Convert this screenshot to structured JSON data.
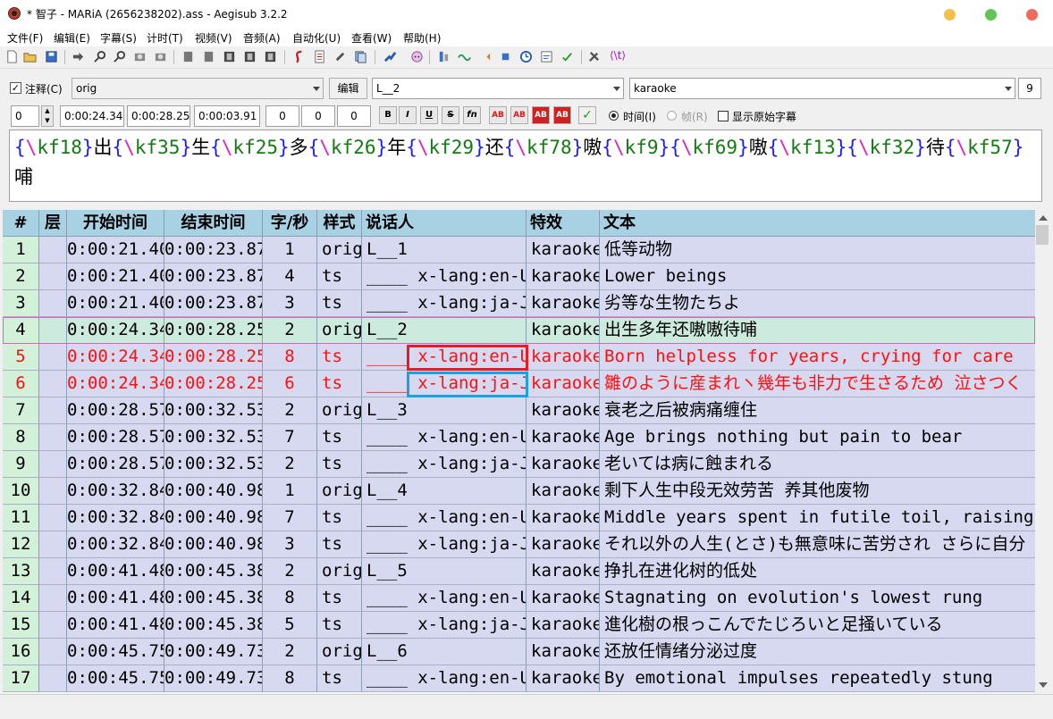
{
  "window": {
    "title": "* 智子 - MARiA (2656238202).ass - Aegisub 3.2.2",
    "buttons": [
      {
        "name": "minimize-button",
        "color": "#f5bf4f"
      },
      {
        "name": "maximize-button",
        "color": "#61c454"
      },
      {
        "name": "close-button",
        "color": "#ee6a5f"
      }
    ]
  },
  "menu": [
    "文件(F)",
    "编辑(E)",
    "字幕(S)",
    "计时(T)",
    "视频(V)",
    "音频(A)",
    "自动化(U)",
    "查看(W)",
    "帮助(H)"
  ],
  "edit": {
    "comment_label": "注释(C)",
    "comment_checked": true,
    "style_value": "orig",
    "edit_button": "编辑",
    "actor_value": "L__2",
    "effect_value": "karaoke",
    "char_count": "9",
    "layer": "0",
    "start_time": "0:00:24.34",
    "end_time": "0:00:28.25",
    "duration": "0:00:03.91",
    "margin_left": "0",
    "margin_right": "0",
    "margin_vert": "0",
    "format_buttons": [
      "B",
      "I",
      "U",
      "S",
      "fn"
    ],
    "color_buttons": [
      "AB",
      "AB",
      "AB",
      "AB"
    ],
    "time_label": "时间(I)",
    "frame_label": "帧(R)",
    "show_original_label": "显示原始字幕",
    "text_tokens": [
      {
        "t": "{",
        "c": "#1e1ef0"
      },
      {
        "t": "\\",
        "c": "#e01ec8"
      },
      {
        "t": "kf18",
        "c": "#147a14"
      },
      {
        "t": "}",
        "c": "#1e1ef0"
      },
      {
        "t": "出",
        "c": "#000000"
      },
      {
        "t": "{",
        "c": "#1e1ef0"
      },
      {
        "t": "\\",
        "c": "#e01ec8"
      },
      {
        "t": "kf35",
        "c": "#147a14"
      },
      {
        "t": "}",
        "c": "#1e1ef0"
      },
      {
        "t": "生",
        "c": "#000000"
      },
      {
        "t": "{",
        "c": "#1e1ef0"
      },
      {
        "t": "\\",
        "c": "#e01ec8"
      },
      {
        "t": "kf25",
        "c": "#147a14"
      },
      {
        "t": "}",
        "c": "#1e1ef0"
      },
      {
        "t": "多",
        "c": "#000000"
      },
      {
        "t": "{",
        "c": "#1e1ef0"
      },
      {
        "t": "\\",
        "c": "#e01ec8"
      },
      {
        "t": "kf26",
        "c": "#147a14"
      },
      {
        "t": "}",
        "c": "#1e1ef0"
      },
      {
        "t": "年",
        "c": "#000000"
      },
      {
        "t": "{",
        "c": "#1e1ef0"
      },
      {
        "t": "\\",
        "c": "#e01ec8"
      },
      {
        "t": "kf29",
        "c": "#147a14"
      },
      {
        "t": "}",
        "c": "#1e1ef0"
      },
      {
        "t": "还",
        "c": "#000000"
      },
      {
        "t": "{",
        "c": "#1e1ef0"
      },
      {
        "t": "\\",
        "c": "#e01ec8"
      },
      {
        "t": "kf78",
        "c": "#147a14"
      },
      {
        "t": "}",
        "c": "#1e1ef0"
      },
      {
        "t": "嗷",
        "c": "#000000"
      },
      {
        "t": "{",
        "c": "#1e1ef0"
      },
      {
        "t": "\\",
        "c": "#e01ec8"
      },
      {
        "t": "kf9",
        "c": "#147a14"
      },
      {
        "t": "}",
        "c": "#1e1ef0"
      },
      {
        "t": "{",
        "c": "#1e1ef0"
      },
      {
        "t": "\\",
        "c": "#e01ec8"
      },
      {
        "t": "kf69",
        "c": "#147a14"
      },
      {
        "t": "}",
        "c": "#1e1ef0"
      },
      {
        "t": "嗷",
        "c": "#000000"
      },
      {
        "t": "{",
        "c": "#1e1ef0"
      },
      {
        "t": "\\",
        "c": "#e01ec8"
      },
      {
        "t": "kf13",
        "c": "#147a14"
      },
      {
        "t": "}",
        "c": "#1e1ef0"
      },
      {
        "t": "{",
        "c": "#1e1ef0"
      },
      {
        "t": "\\",
        "c": "#e01ec8"
      },
      {
        "t": "kf32",
        "c": "#147a14"
      },
      {
        "t": "}",
        "c": "#1e1ef0"
      },
      {
        "t": "待",
        "c": "#000000"
      },
      {
        "t": "{",
        "c": "#1e1ef0"
      },
      {
        "t": "\\",
        "c": "#e01ec8"
      },
      {
        "t": "kf57",
        "c": "#147a14"
      },
      {
        "t": "}",
        "c": "#1e1ef0"
      },
      {
        "t": "哺",
        "c": "#000000"
      }
    ]
  },
  "grid": {
    "headers": [
      "#",
      "层",
      "开始时间",
      "结束时间",
      "字/秒",
      "样式",
      "说话人",
      "特效",
      "文本"
    ],
    "colors": {
      "default_bg": "#d6d9f0",
      "comment_bg": "#d6d9f0",
      "selected_bg": "#cdeade",
      "error_text": "#ff1010"
    },
    "rows": [
      {
        "n": "1",
        "layer": "",
        "start": "0:00:21.40",
        "end": "0:00:23.87",
        "cps": "1",
        "style": "orig",
        "actor": "L__1",
        "effect": "karaoke",
        "text": "低等动物",
        "state": "normal"
      },
      {
        "n": "2",
        "layer": "",
        "start": "0:00:21.40",
        "end": "0:00:23.87",
        "cps": "4",
        "style": "ts",
        "actor": "____ x-lang:en-US",
        "effect": "karaoke",
        "text": "Lower beings",
        "state": "normal"
      },
      {
        "n": "3",
        "layer": "",
        "start": "0:00:21.40",
        "end": "0:00:23.87",
        "cps": "3",
        "style": "ts",
        "actor": "____ x-lang:ja-JP",
        "effect": "karaoke",
        "text": "劣等な生物たちよ",
        "state": "normal"
      },
      {
        "n": "4",
        "layer": "",
        "start": "0:00:24.34",
        "end": "0:00:28.25",
        "cps": "2",
        "style": "orig",
        "actor": "L__2",
        "effect": "karaoke",
        "text": "出生多年还嗷嗷待哺",
        "state": "selected"
      },
      {
        "n": "5",
        "layer": "",
        "start": "0:00:24.34",
        "end": "0:00:28.25",
        "cps": "8",
        "style": "ts",
        "actor": "____ x-lang:en-US",
        "effect": "karaoke",
        "text": "Born helpless for years, crying for care",
        "state": "error"
      },
      {
        "n": "6",
        "layer": "",
        "start": "0:00:24.34",
        "end": "0:00:28.25",
        "cps": "6",
        "style": "ts",
        "actor": "____ x-lang:ja-JP",
        "effect": "karaoke",
        "text": "雛のように産まれヽ幾年も非力で生さるため 泣さつく",
        "state": "error"
      },
      {
        "n": "7",
        "layer": "",
        "start": "0:00:28.57",
        "end": "0:00:32.53",
        "cps": "2",
        "style": "orig",
        "actor": "L__3",
        "effect": "karaoke",
        "text": "衰老之后被病痛缠住",
        "state": "normal"
      },
      {
        "n": "8",
        "layer": "",
        "start": "0:00:28.57",
        "end": "0:00:32.53",
        "cps": "7",
        "style": "ts",
        "actor": "____ x-lang:en-US",
        "effect": "karaoke",
        "text": "Age brings nothing but pain to bear",
        "state": "normal"
      },
      {
        "n": "9",
        "layer": "",
        "start": "0:00:28.57",
        "end": "0:00:32.53",
        "cps": "2",
        "style": "ts",
        "actor": "____ x-lang:ja-JP",
        "effect": "karaoke",
        "text": "老いては病に蝕まれる",
        "state": "normal"
      },
      {
        "n": "10",
        "layer": "",
        "start": "0:00:32.84",
        "end": "0:00:40.98",
        "cps": "1",
        "style": "orig",
        "actor": "L__4",
        "effect": "karaoke",
        "text": "剩下人生中段无效劳苦 养其他废物",
        "state": "normal"
      },
      {
        "n": "11",
        "layer": "",
        "start": "0:00:32.84",
        "end": "0:00:40.98",
        "cps": "7",
        "style": "ts",
        "actor": "____ x-lang:en-US",
        "effect": "karaoke",
        "text": "Middle years spent in futile toil, raising more",
        "state": "normal"
      },
      {
        "n": "12",
        "layer": "",
        "start": "0:00:32.84",
        "end": "0:00:40.98",
        "cps": "3",
        "style": "ts",
        "actor": "____ x-lang:ja-JP",
        "effect": "karaoke",
        "text": "それ以外の人生(とさ)も無意味に苦労され さらに自分",
        "state": "normal"
      },
      {
        "n": "13",
        "layer": "",
        "start": "0:00:41.48",
        "end": "0:00:45.38",
        "cps": "2",
        "style": "orig",
        "actor": "L__5",
        "effect": "karaoke",
        "text": "挣扎在进化树的低处",
        "state": "normal"
      },
      {
        "n": "14",
        "layer": "",
        "start": "0:00:41.48",
        "end": "0:00:45.38",
        "cps": "8",
        "style": "ts",
        "actor": "____ x-lang:en-US",
        "effect": "karaoke",
        "text": "Stagnating on evolution's lowest rung",
        "state": "normal"
      },
      {
        "n": "15",
        "layer": "",
        "start": "0:00:41.48",
        "end": "0:00:45.38",
        "cps": "5",
        "style": "ts",
        "actor": "____ x-lang:ja-JP",
        "effect": "karaoke",
        "text": "進化樹の根っこんでたじろいと足掻いている",
        "state": "normal"
      },
      {
        "n": "16",
        "layer": "",
        "start": "0:00:45.75",
        "end": "0:00:49.73",
        "cps": "2",
        "style": "orig",
        "actor": "L__6",
        "effect": "karaoke",
        "text": "还放任情绪分泌过度",
        "state": "normal"
      },
      {
        "n": "17",
        "layer": "",
        "start": "0:00:45.75",
        "end": "0:00:49.73",
        "cps": "8",
        "style": "ts",
        "actor": "____ x-lang:en-US",
        "effect": "karaoke",
        "text": "By emotional impulses repeatedly stung",
        "state": "normal"
      }
    ]
  },
  "annotations": {
    "red_box_row": 5,
    "blue_box_row": 6
  }
}
